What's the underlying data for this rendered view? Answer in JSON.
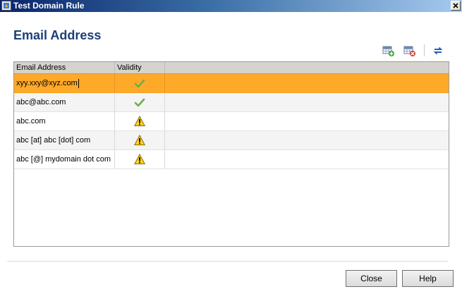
{
  "window": {
    "title": "Test Domain Rule",
    "close_icon": "close-icon",
    "app_icon": "app-icon"
  },
  "page": {
    "title": "Email Address"
  },
  "toolbar": {
    "add_icon": "add-row-icon",
    "delete_icon": "delete-row-icon",
    "refresh_icon": "refresh-icon"
  },
  "grid": {
    "columns": [
      "Email Address",
      "Validity"
    ],
    "rows": [
      {
        "email": "xyy.xxy@xyz.com",
        "validity": "valid"
      },
      {
        "email": "abc@abc.com",
        "validity": "valid"
      },
      {
        "email": "abc.com",
        "validity": "warning"
      },
      {
        "email": "abc [at] abc [dot] com",
        "validity": "warning"
      },
      {
        "email": "abc [@] mydomain dot com",
        "validity": "warning"
      }
    ],
    "selected_row": 0
  },
  "buttons": {
    "close": "Close",
    "help": "Help"
  },
  "colors": {
    "selected_row": "#ffa928",
    "title_text": "#1e3f78",
    "valid_check": "#6ab04c",
    "warning": "#ffd21f"
  }
}
